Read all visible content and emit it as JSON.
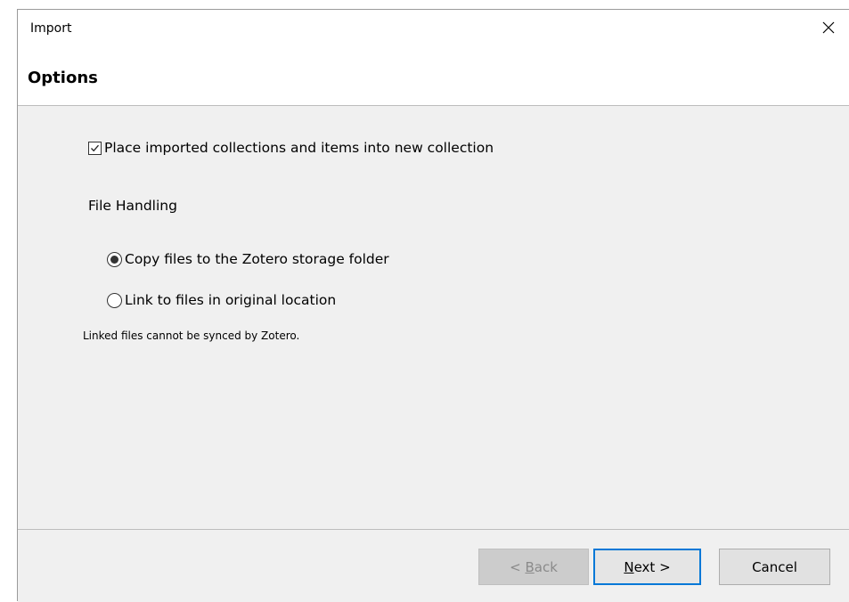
{
  "window": {
    "title": "Import"
  },
  "header": {
    "title": "Options"
  },
  "options": {
    "new_collection_label": "Place imported collections and items into new collection",
    "new_collection_checked": true,
    "file_handling_label": "File Handling",
    "copy_files_label": "Copy files to the Zotero storage folder",
    "copy_files_selected": true,
    "link_files_label": "Link to files in original location",
    "link_files_selected": false,
    "note": "Linked files cannot be synced by Zotero."
  },
  "buttons": {
    "back_prefix": "< ",
    "back_access": "B",
    "back_rest": "ack",
    "back_enabled": false,
    "next_access": "N",
    "next_rest": "ext >",
    "cancel": "Cancel"
  },
  "colors": {
    "focus_border": "#0078d7",
    "content_bg": "#f0f0f0",
    "disabled_text": "#8a8a8a"
  },
  "icons": {
    "close": "close-icon",
    "checkbox": "checkmark-icon",
    "radio": "radio-dot-icon"
  }
}
